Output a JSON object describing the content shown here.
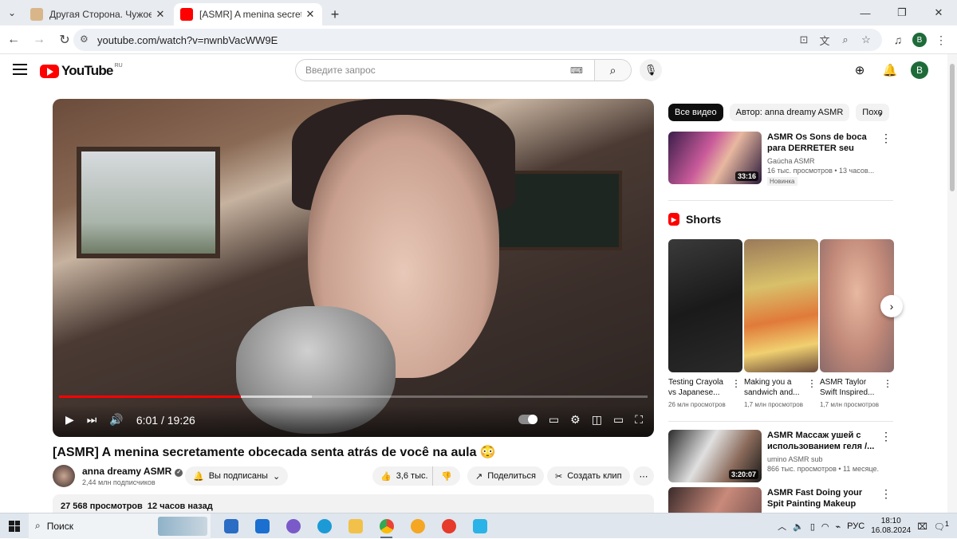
{
  "browser": {
    "tabs": [
      {
        "title": "Другая Сторона. Чужое насле",
        "close": "✕"
      },
      {
        "title": "[ASMR] A menina secretamente",
        "close": "✕"
      }
    ],
    "new_tab": "+",
    "url": "youtube.com/watch?v=nwnbVacWW9E",
    "profile": "B"
  },
  "youtube": {
    "logo_text": "YouTube",
    "region": "RU",
    "search_placeholder": "Введите запрос",
    "avatar": "B"
  },
  "player": {
    "current_time": "6:01",
    "sep": " / ",
    "duration": "19:26",
    "progress_fraction": 0.309,
    "buffered_fraction": 0.43
  },
  "video": {
    "title": "[ASMR] A menina secretamente obcecada senta atrás de você na aula 😳",
    "channel": "anna dreamy ASMR",
    "subscribers": "2,44 млн подписчиков",
    "subscribed_label": "Вы подписаны",
    "likes": "3,6 тыс.",
    "share_label": "Поделиться",
    "clip_label": "Создать клип",
    "views": "27 568 просмотров",
    "ago": "12 часов назад"
  },
  "sidebar": {
    "chips": [
      "Все видео",
      "Автор: anna dreamy ASMR",
      "Похо"
    ],
    "recommended": [
      {
        "title": "ASMR Os Sons de boca para DERRETER seu CÉREBRO...",
        "channel": "Gaúcha ASMR",
        "meta": "16 тыс. просмотров • 13 часов...",
        "badge": "Новинка",
        "duration": "33:16"
      },
      {
        "title": "ASMR Массаж ушей с использованием геля /...",
        "channel": "umino ASMR sub",
        "meta": "866 тыс. просмотров • 11 месяце...",
        "duration": "3:20:07"
      },
      {
        "title": "ASMR Fast Doing your Spit Painting Makeup",
        "channel": "",
        "meta": ""
      }
    ],
    "shorts_title": "Shorts",
    "shorts": [
      {
        "title": "Testing Crayola vs Japanese...",
        "views": "26 млн просмотров"
      },
      {
        "title": "Making you a sandwich and...",
        "views": "1,7 млн просмотров"
      },
      {
        "title": "ASMR Taylor Swift Inspired...",
        "views": "1,7 млн просмотров"
      }
    ]
  },
  "taskbar": {
    "search_label": "Поиск",
    "lang": "РУС",
    "time": "18:10",
    "date": "16.08.2024",
    "notif_count": "1"
  }
}
